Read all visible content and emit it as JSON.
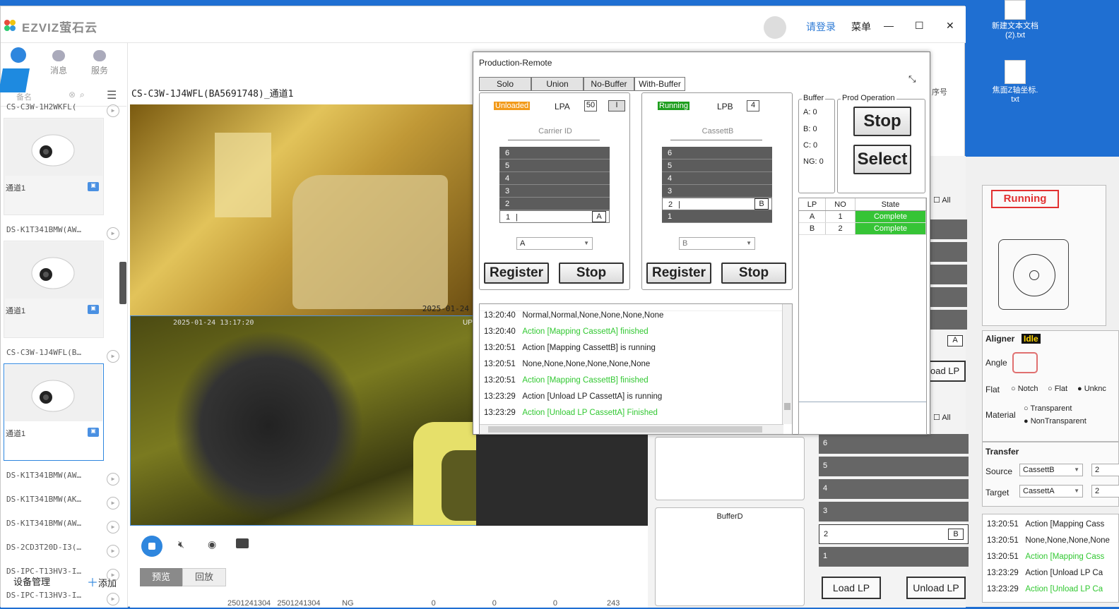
{
  "app": {
    "logo_text": "EZVIZ萤石云",
    "login": "请登录",
    "menu": "菜单",
    "min": "—",
    "max": "☐",
    "close": "✕"
  },
  "sidebar": {
    "tabs": [
      {
        "label": "消息",
        "icon": "message-icon"
      },
      {
        "label": "服务",
        "icon": "services-icon"
      }
    ],
    "search_placeholder": "备名",
    "devices": [
      {
        "type": "row",
        "label": "CS-C3W-1H2WKFL("
      },
      {
        "type": "card",
        "label": "通道1"
      },
      {
        "type": "row",
        "label": "DS-K1T341BMW(AW…"
      },
      {
        "type": "card",
        "label": "通道1"
      },
      {
        "type": "row",
        "label": "CS-C3W-1J4WFL(B…"
      },
      {
        "type": "card",
        "label": "通道1"
      },
      {
        "type": "row",
        "label": "DS-K1T341BMW(AW…"
      },
      {
        "type": "row",
        "label": "DS-K1T341BMW(AK…"
      },
      {
        "type": "row",
        "label": "DS-K1T341BMW(AW…"
      },
      {
        "type": "row",
        "label": "DS-2CD3T20D-I3(…"
      },
      {
        "type": "row",
        "label": "DS-IPC-T13HV3-I…"
      },
      {
        "type": "row",
        "label": "DS-IPC-T13HV3-I…"
      }
    ],
    "device_mgmt": "设备管理",
    "add": "添加"
  },
  "main": {
    "title": "CS-C3W-1J4WFL(BA5691748)_通道1",
    "video1_ts": "2025-01-24",
    "video2_ts": "2025-01-24 13:17:20",
    "video2_tag": "UP",
    "tabs": [
      "预览",
      "回放"
    ],
    "bottom_row": [
      "2501241304",
      "2501241304",
      "NG",
      "0",
      "0",
      "0",
      "243"
    ],
    "right_hint": "序号"
  },
  "prod": {
    "title": "Production-Remote",
    "tabs": [
      "Solo",
      "Union",
      "No-Buffer",
      "With-Buffer"
    ],
    "lpa": {
      "status": "Unloaded",
      "status_color": "#f29a1a",
      "name": "LPA",
      "count": "50",
      "flag": "I",
      "carrier_label": "Carrier ID",
      "slots": [
        "6",
        "5",
        "4",
        "3",
        "2",
        "1"
      ],
      "slot_tag": "A",
      "select": "A",
      "register": "Register",
      "stop": "Stop"
    },
    "lpb": {
      "status": "Running",
      "status_color": "#1e9e1e",
      "name": "LPB",
      "count": "4",
      "carrier_label": "CassettB",
      "slots": [
        "6",
        "5",
        "4",
        "3",
        "2",
        "1"
      ],
      "slot_tag": "B",
      "select": "B",
      "register": "Register",
      "stop": "Stop"
    },
    "buffer": {
      "title": "Buffer",
      "rows": [
        "A: 0",
        "B: 0",
        "C: 0",
        "NG: 0"
      ]
    },
    "prod_op": {
      "title": "Prod Operation",
      "stop": "Stop",
      "select": "Select"
    },
    "lp_table": {
      "headers": [
        "LP",
        "NO",
        "State"
      ],
      "rows": [
        [
          "A",
          "1",
          "Complete"
        ],
        [
          "B",
          "2",
          "Complete"
        ]
      ]
    },
    "log": [
      {
        "t": "13:20:40",
        "m": "Normal,Normal,None,None,None,None",
        "green": false
      },
      {
        "t": "13:20:40",
        "m": "Action [Mapping CassettA] finished",
        "green": true
      },
      {
        "t": "13:20:51",
        "m": "Action [Mapping CassettB] is running",
        "green": false
      },
      {
        "t": "13:20:51",
        "m": "None,None,None,None,None,None",
        "green": false
      },
      {
        "t": "13:20:51",
        "m": "Action [Mapping CassettB] finished",
        "green": true
      },
      {
        "t": "13:23:29",
        "m": "Action [Unload LP CassettA] is running",
        "green": false
      },
      {
        "t": "13:23:29",
        "m": "Action [Unload LP CassettA] Finished",
        "green": true
      }
    ]
  },
  "bg_panel": {
    "all1": "All",
    "all2": "All",
    "oad_lp": "oad LP",
    "a_tag": "A",
    "b_tag": "B",
    "buffer_d": "BufferD",
    "slots": [
      "6",
      "5",
      "4",
      "3",
      "2",
      "1"
    ],
    "load_lp": "Load LP",
    "unload_lp": "Unload LP",
    "running": "Running",
    "aligner": {
      "title": "Aligner",
      "status": "Idle",
      "angle": "Angle",
      "flat": "Flat",
      "flat_opts": [
        "Notch",
        "Flat",
        "Unknc"
      ],
      "material": "Material",
      "mat_opts": [
        "Transparent",
        "NonTransparent"
      ]
    },
    "transfer": {
      "title": "Transfer",
      "source": "Source",
      "source_val": "CassettB",
      "source_n": "2",
      "target": "Target",
      "target_val": "CassettA",
      "target_n": "2"
    },
    "log": [
      {
        "t": "13:20:51",
        "m": "Action [Mapping Cass",
        "green": false
      },
      {
        "t": "13:20:51",
        "m": "None,None,None,None",
        "green": false
      },
      {
        "t": "13:20:51",
        "m": "Action [Mapping Cass",
        "green": true
      },
      {
        "t": "13:23:29",
        "m": "Action [Unload LP Ca",
        "green": false
      },
      {
        "t": "13:23:29",
        "m": "Action [Unload LP Ca",
        "green": true
      }
    ]
  },
  "desktop": {
    "files": [
      {
        "label1": "新建文本文档",
        "label2": "(2).txt"
      },
      {
        "label1": "焦面Z轴坐标.",
        "label2": "txt"
      }
    ]
  }
}
